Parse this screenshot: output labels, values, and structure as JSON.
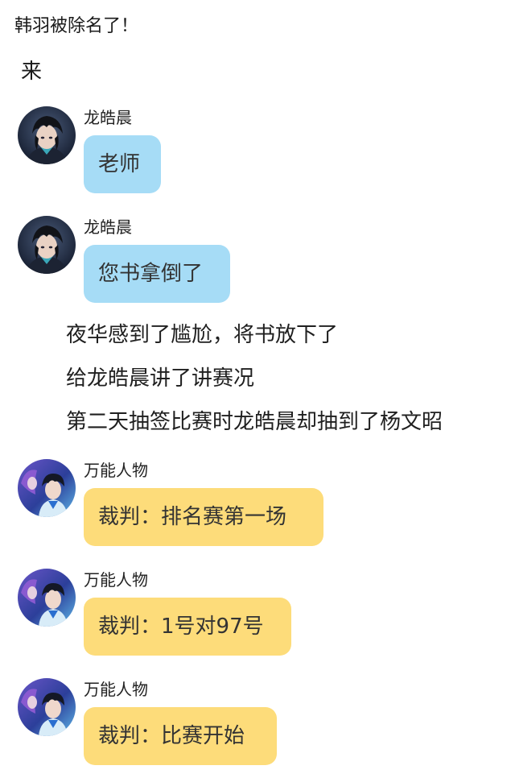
{
  "intro": {
    "line1": "韩羽被除名了！",
    "line2": "来"
  },
  "messages_top": [
    {
      "sender": "龙皓晨",
      "text": "老师",
      "bubble_color": "#a6dcf6",
      "avatar_icon": "character-avatar-longhaochen-icon"
    },
    {
      "sender": "龙皓晨",
      "text": "您书拿倒了",
      "bubble_color": "#a6dcf6",
      "avatar_icon": "character-avatar-longhaochen-icon"
    }
  ],
  "narration": [
    "夜华感到了尴尬，将书放下了",
    "给龙皓晨讲了讲赛况",
    "第二天抽签比赛时龙皓晨却抽到了杨文昭"
  ],
  "messages_bottom": [
    {
      "sender": "万能人物",
      "text": "裁判：排名赛第一场",
      "bubble_color": "#fddc7a",
      "avatar_icon": "character-avatar-universal-icon"
    },
    {
      "sender": "万能人物",
      "text": "裁判：1号对97号",
      "bubble_color": "#fddc7a",
      "avatar_icon": "character-avatar-universal-icon"
    },
    {
      "sender": "万能人物",
      "text": "裁判：比赛开始",
      "bubble_color": "#fddc7a",
      "avatar_icon": "character-avatar-universal-icon"
    }
  ]
}
